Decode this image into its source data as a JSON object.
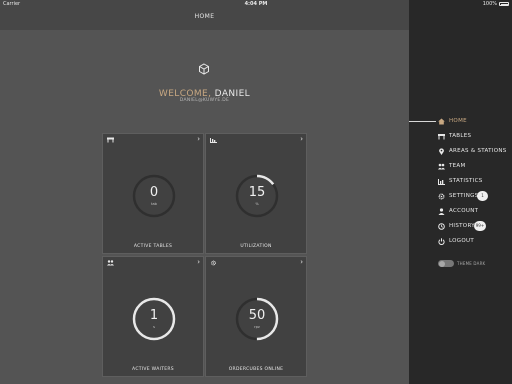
{
  "status_bar": {
    "carrier": "Carrier",
    "time": "4:04 PM",
    "battery": "100%"
  },
  "nav_bar": {
    "title": "HOME"
  },
  "welcome": {
    "greeting": "WELCOME,",
    "name": "DANIEL",
    "email": "DANIEL@KUWYE.DE"
  },
  "tiles": [
    {
      "value": "0",
      "unit": "tab",
      "label": "ACTIVE TABLES",
      "icon": "table-icon",
      "progress": 0
    },
    {
      "value": "15",
      "unit": "%",
      "label": "UTILIZATION",
      "icon": "chart-icon",
      "progress": 0.15
    },
    {
      "value": "1",
      "unit": "s",
      "label": "ACTIVE WAITERS",
      "icon": "team-icon",
      "progress": 1
    },
    {
      "value": "50",
      "unit": "rpv",
      "label": "ORDERCUBES ONLINE",
      "icon": "gear-icon",
      "progress": 0.5
    }
  ],
  "sidebar": {
    "items": [
      {
        "label": "HOME",
        "icon": "home-icon"
      },
      {
        "label": "TABLES",
        "icon": "table-icon"
      },
      {
        "label": "AREAS & STATIONS",
        "icon": "location-pin-icon"
      },
      {
        "label": "TEAM",
        "icon": "team-icon"
      },
      {
        "label": "STATISTICS",
        "icon": "chart-icon"
      },
      {
        "label": "SETTINGS",
        "icon": "gear-icon",
        "badge": "1"
      },
      {
        "label": "ACCOUNT",
        "icon": "user-icon"
      },
      {
        "label": "HISTORY",
        "icon": "clock-icon",
        "badge": "99+"
      },
      {
        "label": "LOGOUT",
        "icon": "power-icon"
      }
    ],
    "theme_toggle": {
      "label": "THEME DARK",
      "on": false
    }
  },
  "colors": {
    "accent": "#c8a882",
    "gauge_track": "#2f2f2f",
    "gauge_ring": "#e8e8e8"
  }
}
